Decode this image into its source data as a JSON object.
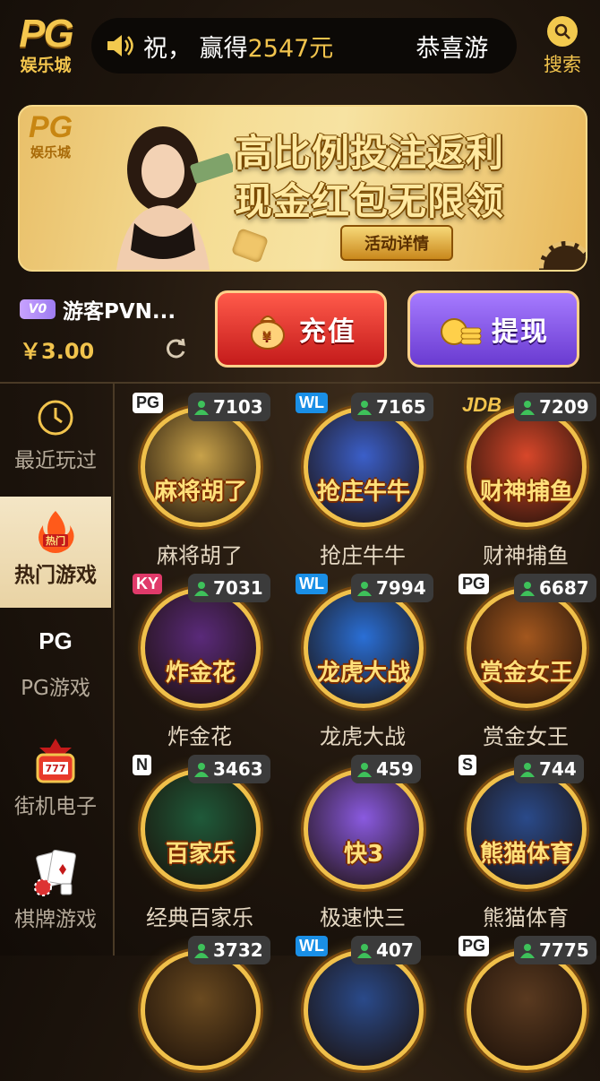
{
  "header": {
    "logo_text": "PG",
    "logo_sub": "娱乐城",
    "marquee_prefix": "， 赢得",
    "marquee_prefix_char": "祝",
    "marquee_amount": "2547元",
    "marquee_next": "恭喜游",
    "search_label": "搜索"
  },
  "banner": {
    "logo_text": "PG",
    "logo_sub": "娱乐城",
    "line1": "高比例投注返利",
    "line2": "现金红包无限领",
    "button": "活动详情"
  },
  "user": {
    "vip_level": "V0",
    "name": "游客PVN...",
    "balance": "￥3.00"
  },
  "actions": {
    "deposit": "充值",
    "withdraw": "提现"
  },
  "sidebar": {
    "items": [
      {
        "label": "最近玩过",
        "icon": "clock-icon"
      },
      {
        "label": "热门游戏",
        "icon": "fire-icon"
      },
      {
        "label": "PG游戏",
        "icon": "pg-logo-icon"
      },
      {
        "label": "街机电子",
        "icon": "slot-machine-icon"
      },
      {
        "label": "棋牌游戏",
        "icon": "cards-icon"
      }
    ]
  },
  "games": [
    {
      "name": "麻将胡了",
      "brand": "PG",
      "players": "7103",
      "art": "麻将胡了",
      "color": "#c8a24a"
    },
    {
      "name": "抢庄牛牛",
      "brand": "WL",
      "players": "7165",
      "art": "抢庄牛牛",
      "color": "#3b5fc9"
    },
    {
      "name": "财神捕鱼",
      "brand": "JDB",
      "players": "7209",
      "art": "财神捕鱼",
      "color": "#d8472a"
    },
    {
      "name": "炸金花",
      "brand": "KY",
      "players": "7031",
      "art": "炸金花",
      "color": "#5a2a7a"
    },
    {
      "name": "龙虎大战",
      "brand": "WL",
      "players": "7994",
      "art": "龙虎大战",
      "color": "#2a6fd6"
    },
    {
      "name": "赏金女王",
      "brand": "PG",
      "players": "6687",
      "art": "赏金女王",
      "color": "#a3571e"
    },
    {
      "name": "经典百家乐",
      "brand": "N",
      "players": "3463",
      "art": "百家乐",
      "color": "#1f5a3a"
    },
    {
      "name": "极速快三",
      "brand": "",
      "players": "459",
      "art": "快3",
      "color": "#8a5ae0"
    },
    {
      "name": "熊猫体育",
      "brand": "S",
      "players": "744",
      "art": "熊猫体育",
      "color": "#2a4a8a"
    },
    {
      "name": "",
      "brand": "",
      "players": "3732",
      "art": "",
      "color": "#6a4a20"
    },
    {
      "name": "",
      "brand": "WL",
      "players": "407",
      "art": "",
      "color": "#2a4a8a"
    },
    {
      "name": "",
      "brand": "PG",
      "players": "7775",
      "art": "",
      "color": "#5a3a20"
    }
  ]
}
